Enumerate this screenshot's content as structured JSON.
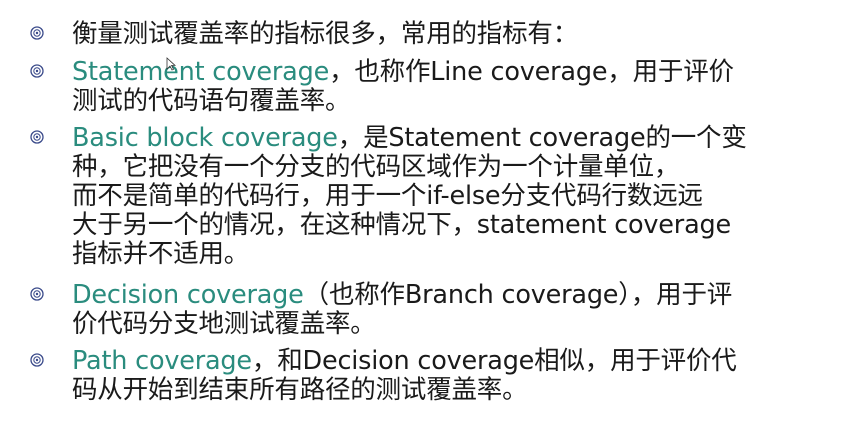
{
  "slide": {
    "colors": {
      "term": "#2a8c7e",
      "text": "#1a1a1a",
      "bullet": "#3a4a8a"
    },
    "icons": {
      "bullet": "flower-bullet-icon",
      "cursor": "mouse-cursor-icon"
    },
    "items": [
      {
        "lines": [
          "衡量测试覆盖率的指标很多，常用的指标有："
        ]
      },
      {
        "term": "Statement coverage",
        "lines": [
          "，也称作Line coverage，用于评价",
          "测试的代码语句覆盖率。"
        ]
      },
      {
        "term": "Basic block coverage",
        "lines": [
          "，是Statement coverage的一个变",
          "种，它把没有一个分支的代码区域作为一个计量单位，",
          "而不是简单的代码行，用于一个if-else分支代码行数远远",
          "大于另一个的情况，在这种情况下，statement coverage",
          "指标并不适用。"
        ]
      },
      {
        "term": "Decision coverage",
        "lines": [
          "（也称作Branch coverage），用于评",
          "价代码分支地测试覆盖率。"
        ]
      },
      {
        "term": "Path coverage",
        "lines": [
          "，和Decision coverage相似，用于评价代",
          "码从开始到结束所有路径的测试覆盖率。"
        ]
      }
    ]
  }
}
